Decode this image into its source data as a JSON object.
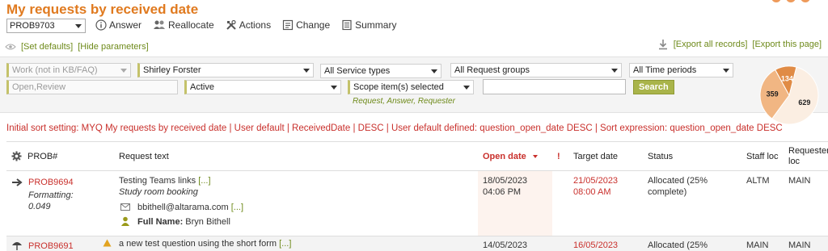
{
  "page": {
    "title": "My requests by received date"
  },
  "header": {
    "request_select_value": "PROB9703"
  },
  "toolbar": {
    "answer_label": "Answer",
    "reallocate_label": "Reallocate",
    "actions_label": "Actions",
    "change_label": "Change",
    "summary_label": "Summary"
  },
  "links": {
    "set_defaults": "[Set defaults]",
    "hide_parameters": "[Hide parameters]",
    "export_all": "[Export all records]",
    "export_page": "[Export this page]"
  },
  "filters": {
    "work_type": "Work (not in KB/FAQ)",
    "staff": "Shirley Forster",
    "service_types": "All Service types",
    "request_groups": "All Request groups",
    "time_periods": "All Time periods",
    "status_filter": "Open,Review",
    "active": "Active",
    "scope": "Scope item(s) selected",
    "scope_sub": "Request, Answer, Requester",
    "search_value": "",
    "search_button": "Search"
  },
  "pie": {
    "slices": [
      {
        "label": "629",
        "value": 629,
        "color": "#fbeee2"
      },
      {
        "label": "359",
        "value": 359,
        "color": "#f1b683"
      },
      {
        "label": "134",
        "value": 134,
        "color": "#e08b45"
      }
    ]
  },
  "sort_setting": "Initial sort setting: MYQ My requests by received date | User default | ReceivedDate | DESC | User default defined: question_open_date DESC | Sort expression: question_open_date DESC",
  "table": {
    "headers": {
      "prob": "PROB#",
      "request_text": "Request text",
      "open_date": "Open date",
      "priority": "!",
      "target_date": "Target date",
      "status": "Status",
      "staff_loc": "Staff loc",
      "requester_loc_1": "Requester",
      "requester_loc_2": "loc"
    },
    "rows": [
      {
        "prob": "PROB9694",
        "formatting_label": "Formatting:",
        "formatting_value": "0.049",
        "title": "Testing Teams links",
        "ellipsis": "[...]",
        "subtitle": "Study room booking",
        "email": "bbithell@altarama.com",
        "email_ellipsis": "[...]",
        "full_name_label": "Full Name:",
        "full_name": "Bryn Bithell",
        "open_date": "18/05/2023",
        "open_time": "04:06 PM",
        "target_date": "21/05/2023",
        "target_time": "08:00 AM",
        "status_1": "Allocated (25%",
        "status_2": "complete)",
        "staff_loc": "ALTM",
        "requester_loc": "MAIN"
      },
      {
        "prob": "PROB9691",
        "title": "a new test question using the short form",
        "ellipsis": "[...]",
        "open_date": "14/05/2023",
        "target_date": "16/05/2023",
        "status_1": "Allocated (25%",
        "staff_loc": "MAIN",
        "requester_loc": "MAIN"
      }
    ]
  }
}
